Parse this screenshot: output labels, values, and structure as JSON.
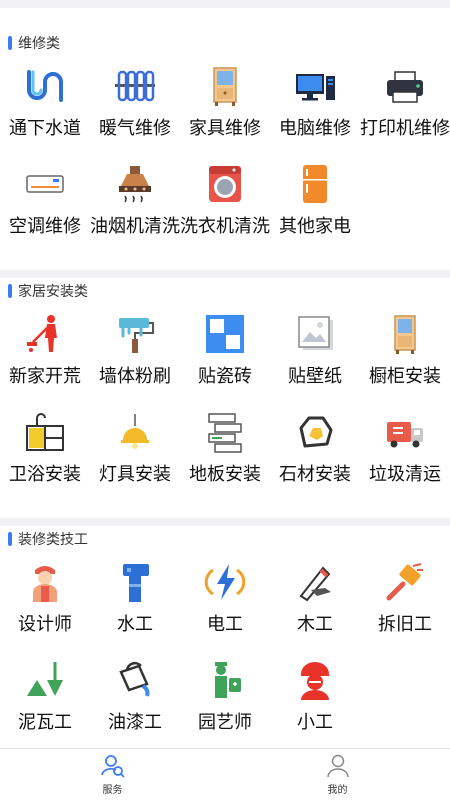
{
  "sections": [
    {
      "title": "维修类",
      "items": [
        {
          "label": "通下水道",
          "icon": "drain-pipe-icon"
        },
        {
          "label": "暖气维修",
          "icon": "radiator-icon"
        },
        {
          "label": "家具维修",
          "icon": "cabinet-icon"
        },
        {
          "label": "电脑维修",
          "icon": "computer-icon"
        },
        {
          "label": "打印机维修",
          "icon": "printer-icon"
        },
        {
          "label": "空调维修",
          "icon": "air-conditioner-icon"
        },
        {
          "label": "油烟机清洗",
          "icon": "range-hood-icon"
        },
        {
          "label": "洗衣机清洗",
          "icon": "washing-machine-icon"
        },
        {
          "label": "其他家电",
          "icon": "refrigerator-icon"
        }
      ]
    },
    {
      "title": "家居安装类",
      "items": [
        {
          "label": "新家开荒",
          "icon": "cleaning-person-icon"
        },
        {
          "label": "墙体粉刷",
          "icon": "paint-roller-icon"
        },
        {
          "label": "贴瓷砖",
          "icon": "tile-icon"
        },
        {
          "label": "贴壁纸",
          "icon": "wallpaper-icon"
        },
        {
          "label": "橱柜安装",
          "icon": "cupboard-icon"
        },
        {
          "label": "卫浴安装",
          "icon": "bathroom-sink-icon"
        },
        {
          "label": "灯具安装",
          "icon": "pendant-lamp-icon"
        },
        {
          "label": "地板安装",
          "icon": "floor-board-icon"
        },
        {
          "label": "石材安装",
          "icon": "stone-icon"
        },
        {
          "label": "垃圾清运",
          "icon": "garbage-truck-icon"
        }
      ]
    },
    {
      "title": "装修类技工",
      "items": [
        {
          "label": "设计师",
          "icon": "designer-icon"
        },
        {
          "label": "水工",
          "icon": "water-pipe-icon"
        },
        {
          "label": "电工",
          "icon": "lightning-icon"
        },
        {
          "label": "木工",
          "icon": "saw-icon"
        },
        {
          "label": "拆旧工",
          "icon": "demolition-hammer-icon"
        },
        {
          "label": "泥瓦工",
          "icon": "trowel-icon"
        },
        {
          "label": "油漆工",
          "icon": "paint-bucket-icon"
        },
        {
          "label": "园艺师",
          "icon": "gardener-icon"
        },
        {
          "label": "小工",
          "icon": "worker-helmet-icon"
        }
      ]
    }
  ],
  "tabbar": {
    "service_label": "服务",
    "mine_label": "我的",
    "active_color": "#3b7cf6"
  }
}
